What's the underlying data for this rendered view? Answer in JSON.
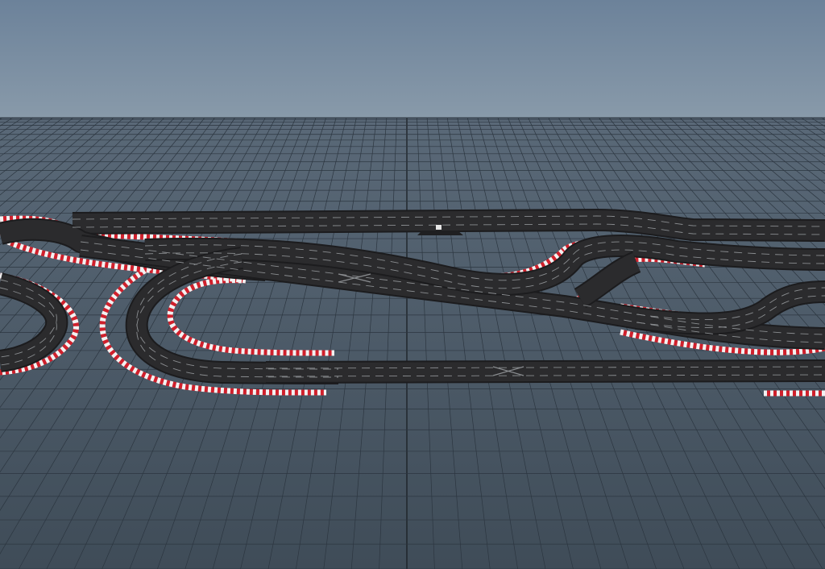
{
  "viewport": {
    "kind": "3d-perspective-viewport",
    "colors": {
      "sky_top": "#6c829a",
      "sky_bottom": "#8b9cab",
      "ground_far": "#5a6978",
      "ground_near": "#3f4c58",
      "grid_line": "#2c3640",
      "grid_axis": "#1a1f24",
      "track_surface": "#2b2b2d",
      "track_edge": "#1c1c1e",
      "lane_marking": "#8a8d90",
      "curb_red": "#d0202c",
      "curb_white": "#f2f2f2"
    }
  },
  "scene": {
    "objects": [
      {
        "name": "slot-car-track",
        "type": "track-layout"
      },
      {
        "name": "ground-grid",
        "type": "grid-plane"
      }
    ]
  }
}
